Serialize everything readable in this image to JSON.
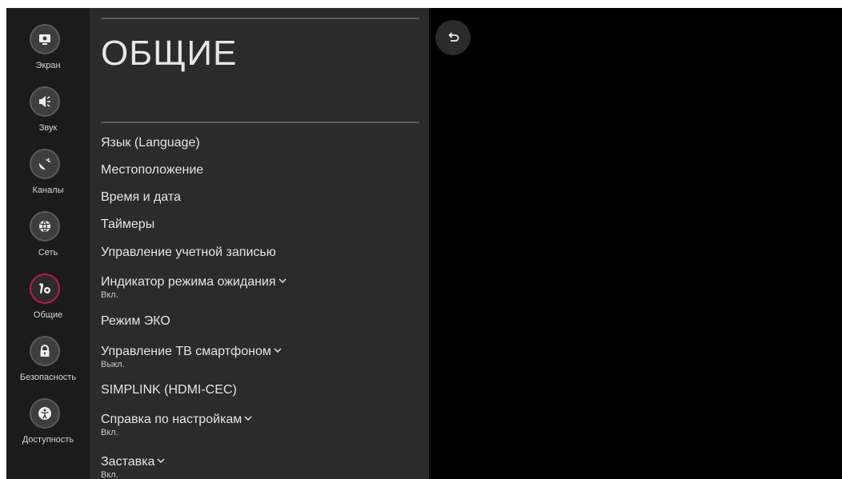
{
  "sidebar": {
    "items": [
      {
        "label": "Экран",
        "icon": "screen-icon"
      },
      {
        "label": "Звук",
        "icon": "sound-icon"
      },
      {
        "label": "Каналы",
        "icon": "satellite-icon"
      },
      {
        "label": "Сеть",
        "icon": "globe-icon"
      },
      {
        "label": "Общие",
        "icon": "wrench-gear-icon",
        "active": true
      },
      {
        "label": "Безопасность",
        "icon": "lock-icon"
      },
      {
        "label": "Доступность",
        "icon": "accessibility-icon"
      }
    ]
  },
  "panel": {
    "title": "ОБЩИЕ",
    "items": [
      {
        "label": "Язык (Language)"
      },
      {
        "label": "Местоположение"
      },
      {
        "label": "Время и дата"
      },
      {
        "label": "Таймеры"
      },
      {
        "label": "Управление учетной записью"
      },
      {
        "label": "Индикатор режима ожидания",
        "value": "Вкл."
      },
      {
        "label": "Режим ЭКО"
      },
      {
        "label": "Управление ТВ смартфоном",
        "value": "Выкл."
      },
      {
        "label": "SIMPLINK (HDMI-CEC)"
      },
      {
        "label": "Справка по настройкам",
        "value": "Вкл."
      },
      {
        "label": "Заставка",
        "value": "Вкл."
      }
    ]
  },
  "back_button": {
    "icon": "back-arrow-icon"
  },
  "colors": {
    "accent": "#c4164b",
    "panel_bg": "#2b2b2b",
    "sidebar_bg": "#1b1b1b",
    "screen_bg": "#000000"
  }
}
